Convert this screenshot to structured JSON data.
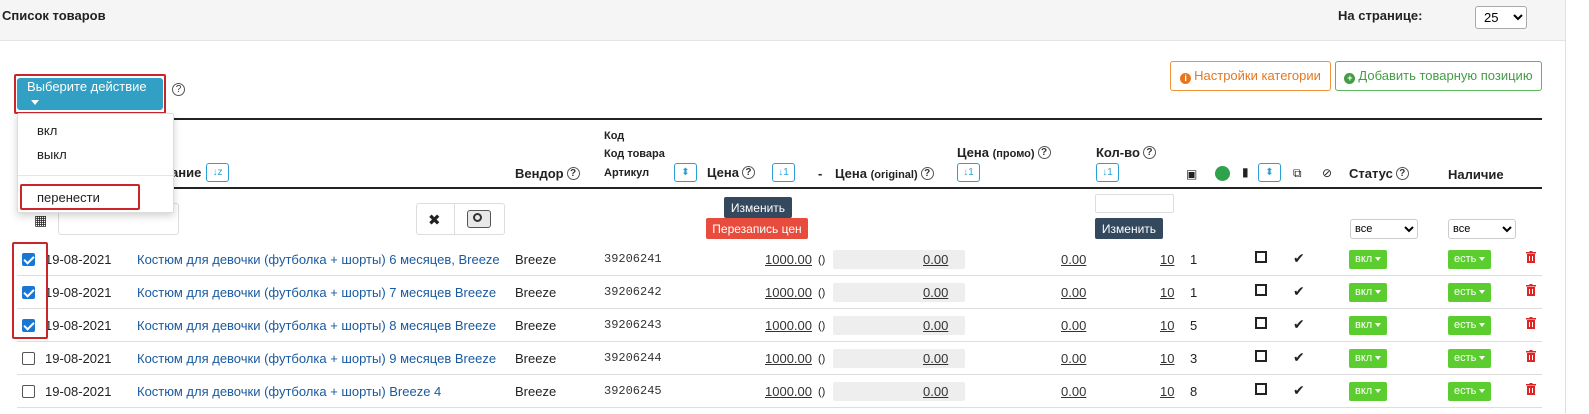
{
  "header": {
    "title": "Список товаров",
    "perpage_label": "На странице:",
    "perpage_value": "25"
  },
  "actions": {
    "select_action_label": "Выберите действие",
    "dropdown_items": [
      "вкл",
      "выкл",
      "перенести"
    ],
    "category_settings_label": "Настройки категории",
    "add_product_label": "Добавить товарную позицию"
  },
  "columns": {
    "name_partial": "ание",
    "vendor": "Вендор",
    "code": "Код",
    "product_code": "Код товара",
    "article": "Артикул",
    "price": "Цена",
    "dash": "-",
    "price_original": "Цена",
    "price_original_small": "(original)",
    "price_promo": "Цена",
    "price_promo_small": "(промо)",
    "qty": "Кол-во",
    "status": "Статус",
    "availability": "Наличие"
  },
  "filters": {
    "change_label": "Изменить",
    "rewrite_prices_label": "Перезапись цен",
    "qty_change_label": "Изменить",
    "status_all": "все",
    "availability_all": "все"
  },
  "rows": [
    {
      "checked": true,
      "date": "19-08-2021",
      "name": "Костюм для девочки (футболка + шорты) 6 месяцев, Breeze",
      "vendor": "Breeze",
      "code": "39206241",
      "price": "1000.00",
      "paren": "()",
      "original": "0.00",
      "promo": "0.00",
      "qty": "10",
      "images": "1",
      "status": "вкл",
      "availability": "есть"
    },
    {
      "checked": true,
      "date": "19-08-2021",
      "name": "Костюм для девочки (футболка + шорты) 7 месяцев Breeze",
      "vendor": "Breeze",
      "code": "39206242",
      "price": "1000.00",
      "paren": "()",
      "original": "0.00",
      "promo": "0.00",
      "qty": "10",
      "images": "1",
      "status": "вкл",
      "availability": "есть"
    },
    {
      "checked": true,
      "date": "19-08-2021",
      "name": "Костюм для девочки (футболка + шорты) 8 месяцев Breeze",
      "vendor": "Breeze",
      "code": "39206243",
      "price": "1000.00",
      "paren": "()",
      "original": "0.00",
      "promo": "0.00",
      "qty": "10",
      "images": "5",
      "status": "вкл",
      "availability": "есть"
    },
    {
      "checked": false,
      "date": "19-08-2021",
      "name": "Костюм для девочки (футболка + шорты) 9 месяцев Breeze",
      "vendor": "Breeze",
      "code": "39206244",
      "price": "1000.00",
      "paren": "()",
      "original": "0.00",
      "promo": "0.00",
      "qty": "10",
      "images": "3",
      "status": "вкл",
      "availability": "есть"
    },
    {
      "checked": false,
      "date": "19-08-2021",
      "name": "Костюм для девочки (футболка + шорты) Breeze 4",
      "vendor": "Breeze",
      "code": "39206245",
      "price": "1000.00",
      "paren": "()",
      "original": "0.00",
      "promo": "0.00",
      "qty": "10",
      "images": "8",
      "status": "вкл",
      "availability": "есть"
    }
  ],
  "colors": {
    "primary": "#31a0c4",
    "highlight": "#c9262c",
    "green": "#5ccd2e",
    "dark": "#34495e",
    "red": "#e74c3c",
    "orange": "#f0943b"
  }
}
